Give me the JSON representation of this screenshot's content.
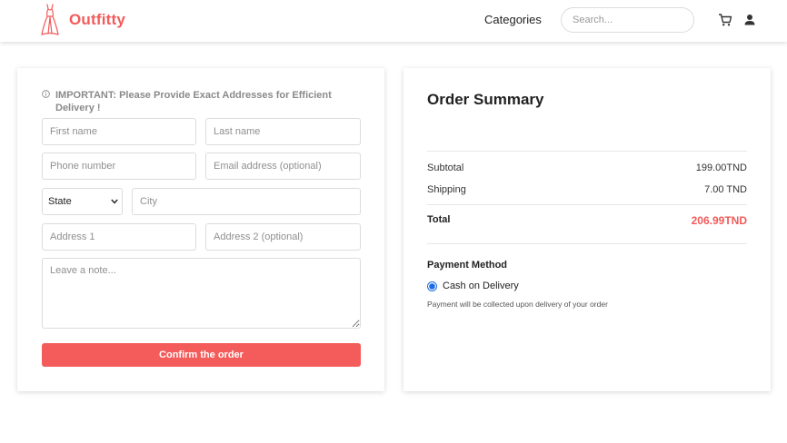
{
  "header": {
    "brand": "Outfitty",
    "nav_categories": "Categories",
    "search_placeholder": "Search..."
  },
  "form": {
    "notice": "IMPORTANT: Please Provide Exact Addresses for Efficient Delivery !",
    "first_name_placeholder": "First name",
    "last_name_placeholder": "Last name",
    "phone_placeholder": "Phone number",
    "email_placeholder": "Email address (optional)",
    "state_selected": "State",
    "city_placeholder": "City",
    "address1_placeholder": "Address 1",
    "address2_placeholder": "Address 2 (optional)",
    "note_placeholder": "Leave a note...",
    "confirm_label": "Confirm the order"
  },
  "summary": {
    "title": "Order Summary",
    "subtotal_label": "Subtotal",
    "subtotal_value": "199.00TND",
    "shipping_label": "Shipping",
    "shipping_value": "7.00 TND",
    "total_label": "Total",
    "total_value": "206.99TND",
    "payment_title": "Payment Method",
    "payment_option": "Cash on Delivery",
    "payment_note": "Payment will be collected upon delivery of your order"
  },
  "colors": {
    "accent": "#f45b5b",
    "radio": "#1a6de0"
  },
  "icons": [
    "dress-logo-icon",
    "info-icon",
    "cart-icon",
    "user-icon",
    "chevron-down-icon"
  ]
}
